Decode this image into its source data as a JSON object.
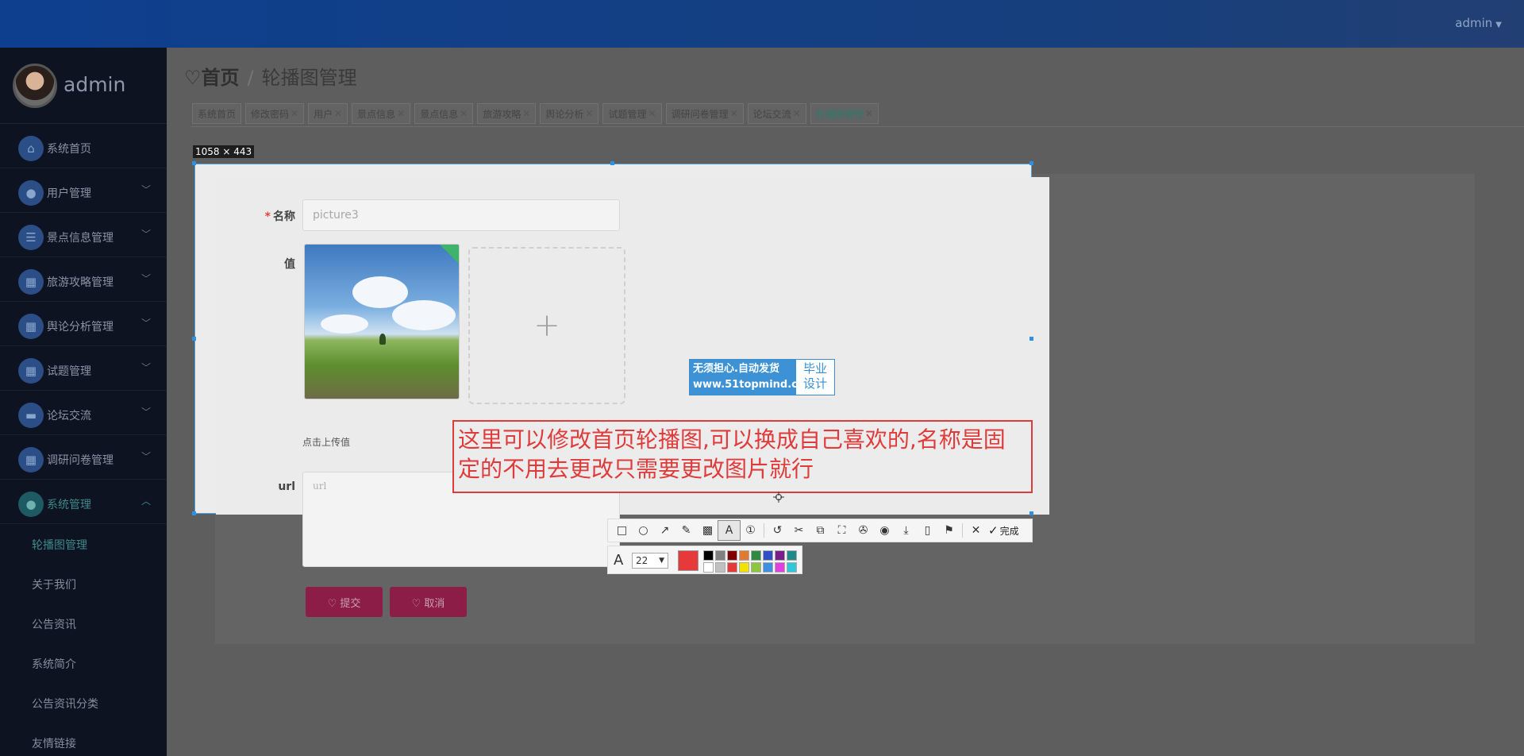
{
  "topbar": {
    "user": "admin",
    "caret": "▼"
  },
  "sidebar": {
    "profile_name": "admin",
    "items": [
      {
        "label": "系统首页",
        "icon": "⌂",
        "chevron": ""
      },
      {
        "label": "用户管理",
        "icon": "●",
        "chevron": "﹀"
      },
      {
        "label": "景点信息管理",
        "icon": "☰",
        "chevron": "﹀"
      },
      {
        "label": "旅游攻略管理",
        "icon": "▦",
        "chevron": "﹀"
      },
      {
        "label": "舆论分析管理",
        "icon": "▦",
        "chevron": "﹀"
      },
      {
        "label": "试题管理",
        "icon": "▦",
        "chevron": "﹀"
      },
      {
        "label": "论坛交流",
        "icon": "▬",
        "chevron": "﹀"
      },
      {
        "label": "调研问卷管理",
        "icon": "▦",
        "chevron": "﹀"
      },
      {
        "label": "系统管理",
        "icon": "●",
        "chevron": "︿"
      }
    ],
    "sub_items": [
      "轮播图管理",
      "关于我们",
      "公告资讯",
      "系统简介",
      "公告资讯分类",
      "友情链接"
    ]
  },
  "breadcrumb": {
    "home": "首页",
    "separator": "/",
    "current": "轮播图管理"
  },
  "tabs": [
    {
      "label": "系统首页",
      "closable": false
    },
    {
      "label": "修改密码",
      "closable": true
    },
    {
      "label": "用户",
      "closable": true
    },
    {
      "label": "景点信息",
      "closable": true
    },
    {
      "label": "景点信息",
      "closable": true
    },
    {
      "label": "旅游攻略",
      "closable": true
    },
    {
      "label": "舆论分析",
      "closable": true
    },
    {
      "label": "试题管理",
      "closable": true
    },
    {
      "label": "调研问卷管理",
      "closable": true
    },
    {
      "label": "论坛交流",
      "closable": true
    },
    {
      "label": "轮播图管理",
      "closable": true
    }
  ],
  "screenshot_tool": {
    "size_label": "1058 × 443",
    "annotation_text": "这里可以修改首页轮播图,可以换成自己喜欢的,名称是固定的不用去更改只需要更改图片就行",
    "done_label": "完成",
    "font_size": "22",
    "current_color": "#e63a3a",
    "palette": [
      "#000000",
      "#808080",
      "#800000",
      "#e07a30",
      "#2e8b3e",
      "#2f50c8",
      "#7a1f8a",
      "#1e8a8a",
      "#ffffff",
      "#c0c0c0",
      "#e63a3a",
      "#f2e200",
      "#8cc63f",
      "#3f8fe0",
      "#e040e0",
      "#30c8d8"
    ],
    "tools": [
      "rectangle-icon",
      "ellipse-icon",
      "arrow-icon",
      "pen-icon",
      "mosaic-icon",
      "text-icon",
      "number-icon",
      "undo-icon",
      "cut-icon",
      "ocr-icon",
      "fullscreen-icon",
      "pin-icon",
      "record-icon",
      "download-icon",
      "phone-icon",
      "bookmark-icon",
      "close-icon"
    ]
  },
  "form": {
    "name_label": "名称",
    "name_required": "*",
    "name_value": "picture3",
    "value_label": "值",
    "upload_plus": "+",
    "upload_tip": "点击上传值",
    "url_label": "url",
    "url_placeholder": "url",
    "submit_label": "♡ 提交",
    "cancel_label": "♡ 取消"
  },
  "watermark": {
    "line1": "无须担心.自动发货",
    "line2": "www.51topmind.com",
    "right1": "毕业",
    "right2": "设计"
  }
}
